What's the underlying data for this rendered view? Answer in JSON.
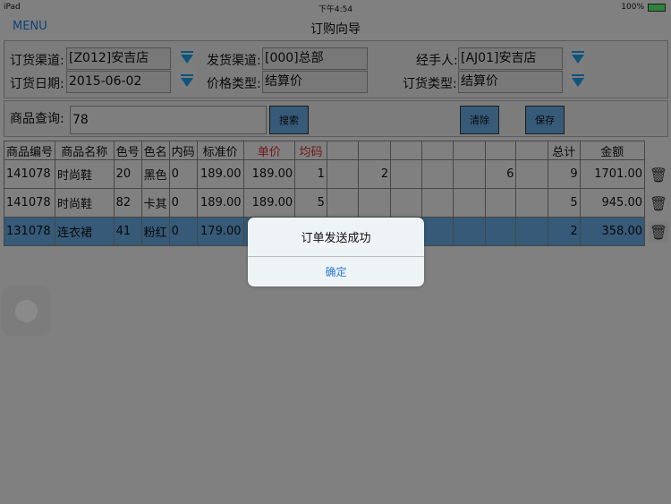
{
  "status": {
    "device": "iPad",
    "time": "下午4:54",
    "battery": "100%"
  },
  "nav": {
    "menu": "MENU",
    "title": "订购向导"
  },
  "form": {
    "order_channel_label": "订货渠道:",
    "order_channel": "[Z012]安吉店",
    "ship_channel_label": "发货渠道:",
    "ship_channel": "[000]总部",
    "handler_label": "经手人:",
    "handler": "[AJ01]安吉店",
    "order_date_label": "订货日期:",
    "order_date": "2015-06-02",
    "price_type_label": "价格类型:",
    "price_type": "结算价",
    "order_type_label": "订货类型:",
    "order_type": "结算价"
  },
  "search": {
    "label": "商品查询:",
    "value": "78",
    "search": "搜索",
    "clear": "清除",
    "save": "保存"
  },
  "table": {
    "headers": [
      "商品编号",
      "商品名称",
      "色号",
      "色名",
      "内码",
      "标准价",
      "单价",
      "均码",
      "",
      "",
      "",
      "",
      "",
      "",
      "",
      "总计",
      "金额"
    ],
    "rows": [
      [
        "141078",
        "时尚鞋",
        "20",
        "黑色",
        "0",
        "189.00",
        "189.00",
        "1",
        "",
        "2",
        "",
        "",
        "",
        "6",
        "",
        "9",
        "1701.00"
      ],
      [
        "141078",
        "时尚鞋",
        "82",
        "卡其",
        "0",
        "189.00",
        "189.00",
        "5",
        "",
        "",
        "",
        "",
        "",
        "",
        "",
        "5",
        "945.00"
      ],
      [
        "131078",
        "连衣裙",
        "41",
        "粉红",
        "0",
        "179.00",
        "",
        "",
        "",
        "",
        "",
        "",
        "",
        "",
        "",
        "2",
        "358.00"
      ]
    ]
  },
  "alert": {
    "message": "订单发送成功",
    "ok": "确定"
  },
  "colors": {
    "accent": "#5b96c9",
    "dropdown": "#1a8ccc",
    "red": "#c0282d"
  }
}
